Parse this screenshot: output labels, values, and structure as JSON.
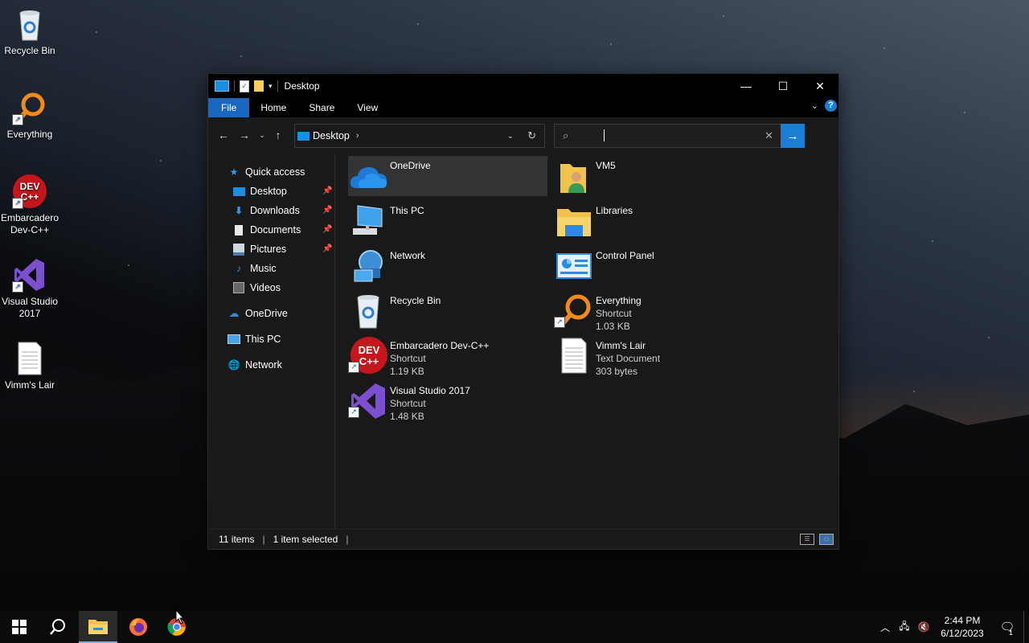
{
  "desktop": {
    "icons": [
      {
        "label": "Recycle Bin",
        "icon": "recycle-bin-icon"
      },
      {
        "label": "Everything",
        "icon": "everything-icon",
        "shortcut": true
      },
      {
        "label": "Embarcadero Dev-C++",
        "icon": "devcpp-icon",
        "shortcut": true
      },
      {
        "label": "Visual Studio 2017",
        "icon": "visual-studio-icon",
        "shortcut": true
      },
      {
        "label": "Vimm's Lair",
        "icon": "text-document-icon"
      }
    ]
  },
  "window": {
    "title": "Desktop",
    "ribbon_tabs": [
      "File",
      "Home",
      "Share",
      "View"
    ],
    "address": {
      "crumb": "Desktop"
    },
    "search": {
      "placeholder": "",
      "value": ""
    },
    "nav": {
      "quick_access": "Quick access",
      "pinned": [
        "Desktop",
        "Downloads",
        "Documents",
        "Pictures"
      ],
      "unpinned": [
        "Music",
        "Videos"
      ],
      "roots": [
        "OneDrive",
        "This PC",
        "Network"
      ]
    },
    "items": [
      {
        "name": "OneDrive",
        "type": "",
        "size": "",
        "icon": "onedrive-icon",
        "selected": true
      },
      {
        "name": "VM5",
        "type": "",
        "size": "",
        "icon": "user-folder-icon"
      },
      {
        "name": "This PC",
        "type": "",
        "size": "",
        "icon": "this-pc-icon"
      },
      {
        "name": "Libraries",
        "type": "",
        "size": "",
        "icon": "libraries-icon"
      },
      {
        "name": "Network",
        "type": "",
        "size": "",
        "icon": "network-icon"
      },
      {
        "name": "Control Panel",
        "type": "",
        "size": "",
        "icon": "control-panel-icon"
      },
      {
        "name": "Recycle Bin",
        "type": "",
        "size": "",
        "icon": "recycle-bin-icon"
      },
      {
        "name": "Everything",
        "type": "Shortcut",
        "size": "1.03 KB",
        "icon": "everything-icon"
      },
      {
        "name": "Embarcadero Dev-C++",
        "type": "Shortcut",
        "size": "1.19 KB",
        "icon": "devcpp-icon"
      },
      {
        "name": "Vimm's Lair",
        "type": "Text Document",
        "size": "303 bytes",
        "icon": "text-document-icon"
      },
      {
        "name": "Visual Studio 2017",
        "type": "Shortcut",
        "size": "1.48 KB",
        "icon": "visual-studio-icon"
      }
    ],
    "status": {
      "count": "11 items",
      "selected": "1 item selected"
    }
  },
  "taskbar": {
    "clock_time": "2:44 PM",
    "clock_date": "6/12/2023",
    "notification_count": "1"
  },
  "colors": {
    "accent": "#1a7fd4",
    "file_tab": "#1a67c2"
  }
}
